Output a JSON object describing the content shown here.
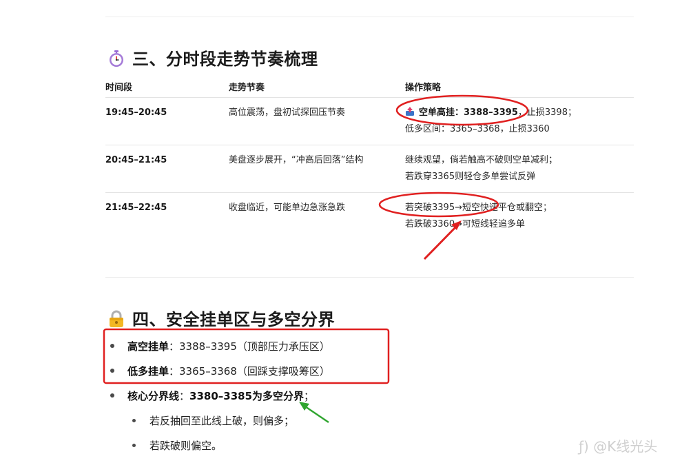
{
  "section3": {
    "icon": "stopwatch-icon",
    "title": "三、分时段走势节奏梳理",
    "headers": [
      "时间段",
      "走势节奏",
      "操作策略"
    ],
    "rows": [
      {
        "time": "19:45–20:45",
        "trend": "高位震荡，盘初试探回压节奏",
        "strategy_icon": "down-arrow-box-icon",
        "strategy_line1_bold": "空单高挂：3388–3395",
        "strategy_line1_rest": "，止损3398；",
        "strategy_line2": "低多区间：3365–3368，止损3360"
      },
      {
        "time": "20:45–21:45",
        "trend": "美盘逐步展开，“冲高后回落”结构",
        "strategy_line1": "继续观望，倘若触高不破则空单减利；",
        "strategy_line2": "若跌穿3365则轻仓多单尝试反弹"
      },
      {
        "time": "21:45–22:45",
        "trend": "收盘临近，可能单边急涨急跌",
        "strategy_line1": "若突破3395→短空快速平仓或翻空；",
        "strategy_line2": "若跌破3360→可短线轻追多单"
      }
    ]
  },
  "section4": {
    "icon": "lock-icon",
    "title": "四、安全挂单区与多空分界",
    "items": [
      {
        "bold": "高空挂单",
        "rest": "：3388–3395（顶部压力承压区）"
      },
      {
        "bold": "低多挂单",
        "rest": "：3365–3368（回踩支撑吸筹区）"
      },
      {
        "bold": "核心分界线",
        "rest_prefix": "：",
        "bold2": "3380–3385为多空分界",
        "rest": "；"
      }
    ],
    "subitems": [
      "若反抽回至此线上破，则偏多；",
      "若跌破则偏空。"
    ]
  },
  "watermark": "ƒ) @K线光头",
  "colors": {
    "annotation_red": "#e02020",
    "annotation_green": "#2fa52f",
    "table_line": "#e3e3e3"
  }
}
